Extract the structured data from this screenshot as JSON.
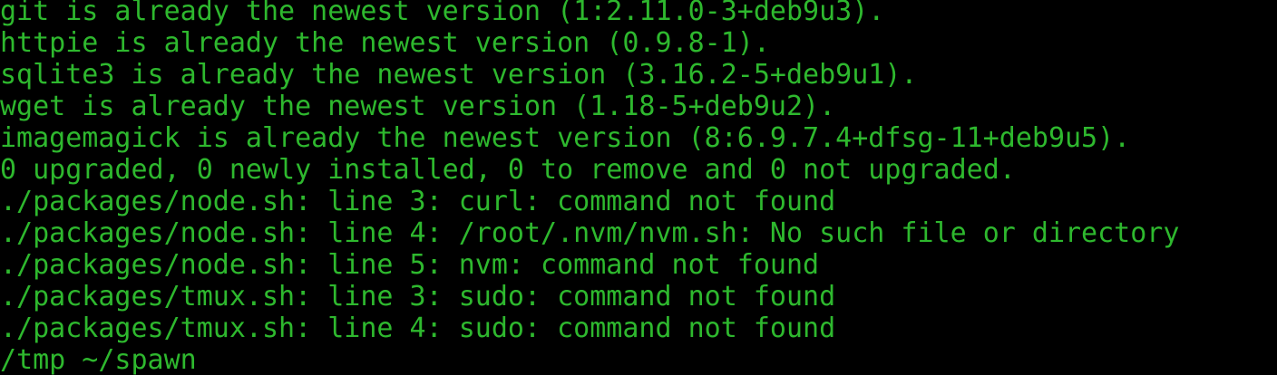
{
  "terminal": {
    "colors": {
      "background": "#000000",
      "foreground": "#2eb82e"
    },
    "lines": [
      "git is already the newest version (1:2.11.0-3+deb9u3).",
      "httpie is already the newest version (0.9.8-1).",
      "sqlite3 is already the newest version (3.16.2-5+deb9u1).",
      "wget is already the newest version (1.18-5+deb9u2).",
      "imagemagick is already the newest version (8:6.9.7.4+dfsg-11+deb9u5).",
      "0 upgraded, 0 newly installed, 0 to remove and 0 not upgraded.",
      "./packages/node.sh: line 3: curl: command not found",
      "./packages/node.sh: line 4: /root/.nvm/nvm.sh: No such file or directory",
      "./packages/node.sh: line 5: nvm: command not found",
      "./packages/tmux.sh: line 3: sudo: command not found",
      "./packages/tmux.sh: line 4: sudo: command not found",
      "/tmp ~/spawn"
    ]
  }
}
